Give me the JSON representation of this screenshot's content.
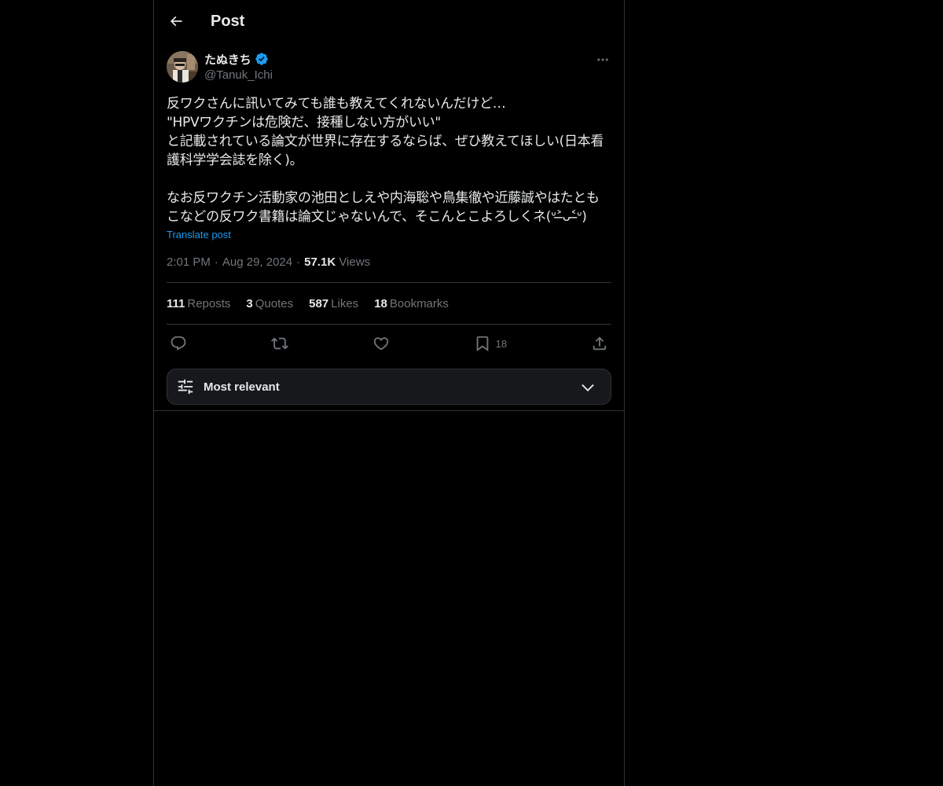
{
  "header": {
    "title": "Post"
  },
  "post": {
    "author": {
      "display_name": "たぬきち",
      "handle": "@Tanuk_Ichi",
      "verified": true
    },
    "text": "反ワクさんに訊いてみても誰も教えてくれないんだけど…\n\"HPVワクチンは危険だ、接種しない方がいい\"\nと記載されている論文が世界に存在するならば、ぜひ教えてほしい(日本看護科学学会誌を除く)。\n\nなお反ワクチン活動家の池田としえや内海聡や鳥集徹や近藤誠やはたともこなどの反ワク書籍は論文じゃないんで、そこんとこよろしくネ(ᐡ˃̶ᴗ˂̶ᐡ)",
    "translate_label": "Translate post",
    "time": "2:01 PM",
    "date": "Aug 29, 2024",
    "views_count": "57.1K",
    "views_label": "Views",
    "separator": "·"
  },
  "stats": [
    {
      "count": "111",
      "label": "Reposts"
    },
    {
      "count": "3",
      "label": "Quotes"
    },
    {
      "count": "587",
      "label": "Likes"
    },
    {
      "count": "18",
      "label": "Bookmarks"
    }
  ],
  "actions": {
    "bookmark_count": "18"
  },
  "sort": {
    "label": "Most relevant"
  },
  "colors": {
    "background": "#000000",
    "text": "#e7e9ea",
    "secondary": "#71767b",
    "accent": "#1d9bf0",
    "border": "#2f3336"
  },
  "icons": [
    "back-arrow-icon",
    "verified-badge-icon",
    "more-icon",
    "reply-icon",
    "repost-icon",
    "like-icon",
    "bookmark-icon",
    "share-icon",
    "sort-sliders-icon",
    "chevron-down-icon"
  ]
}
